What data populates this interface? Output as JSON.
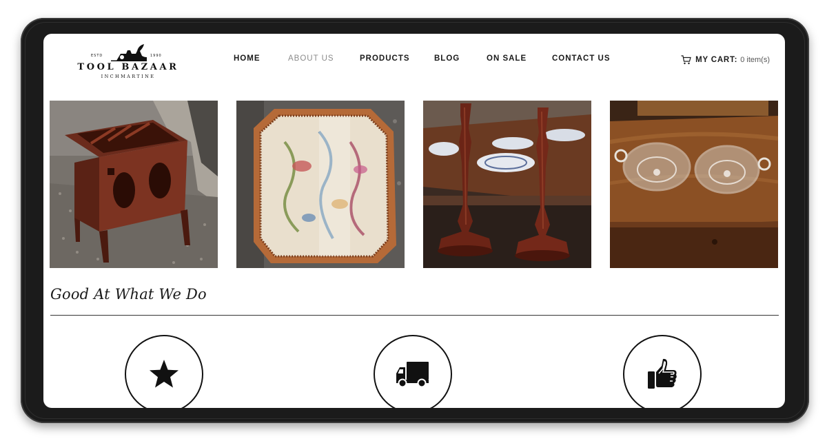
{
  "logo": {
    "estd": "ESTD",
    "year": "1990",
    "brand": "TOOL BAZAAR",
    "location": "INCHMARTINE"
  },
  "nav": {
    "items": [
      {
        "label": "HOME"
      },
      {
        "label": "ABOUT US"
      },
      {
        "label": "PRODUCTS"
      },
      {
        "label": "BLOG"
      },
      {
        "label": "ON SALE"
      },
      {
        "label": "CONTACT US"
      }
    ],
    "active_index": 1
  },
  "cart": {
    "icon": "cart-icon",
    "label": "MY CART:",
    "count": "0 item(s)"
  },
  "gallery": [
    {
      "subject": "carved-wooden-magazine-rack"
    },
    {
      "subject": "framed-embroidered-panel"
    },
    {
      "subject": "pair-of-mahogany-candlesticks"
    },
    {
      "subject": "pair-of-glass-bowls"
    }
  ],
  "section": {
    "title": "Good At What We Do"
  },
  "features": [
    {
      "icon": "star-icon"
    },
    {
      "icon": "truck-icon"
    },
    {
      "icon": "thumbs-up-icon"
    }
  ],
  "colors": {
    "frame": "#1b1b1b",
    "text": "#1a1a1a",
    "nav_active": "#8b8b8b"
  }
}
